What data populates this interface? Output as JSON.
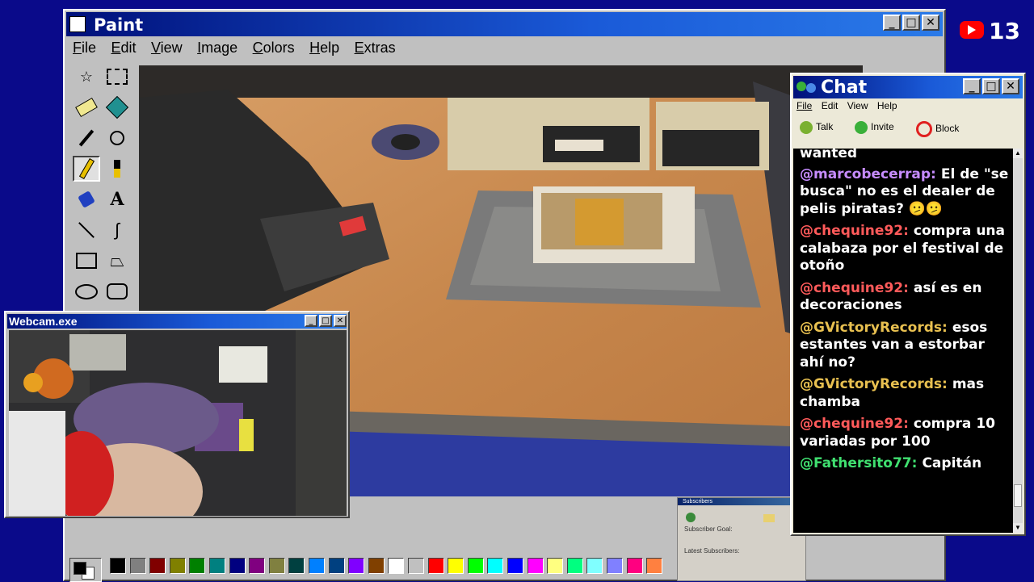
{
  "paint": {
    "title": "Paint",
    "menu": [
      "File",
      "Edit",
      "View",
      "Image",
      "Colors",
      "Help",
      "Extras"
    ],
    "tools": [
      "free-select-icon",
      "rect-select-icon",
      "eraser-icon",
      "fill-bucket-icon",
      "color-picker-icon",
      "magnifier-icon",
      "pencil-icon",
      "brush-icon",
      "airbrush-icon",
      "text-icon",
      "line-icon",
      "curve-icon",
      "rectangle-icon",
      "polygon-icon",
      "ellipse-icon",
      "rounded-rect-icon"
    ],
    "palette": [
      "#000000",
      "#808080",
      "#800000",
      "#808000",
      "#008000",
      "#008080",
      "#000080",
      "#800080",
      "#808040",
      "#004040",
      "#0080ff",
      "#004080",
      "#8000ff",
      "#804000",
      "#ffffff",
      "#c0c0c0",
      "#ff0000",
      "#ffff00",
      "#00ff00",
      "#00ffff",
      "#0000ff",
      "#ff00ff",
      "#ffff80",
      "#00ff80",
      "#80ffff",
      "#8080ff",
      "#ff0080",
      "#ff8040"
    ],
    "primary_color": "#000000",
    "secondary_color": "#ffffff"
  },
  "badge": {
    "count": "13",
    "icon": "youtube-icon"
  },
  "webcam": {
    "title": "Webcam.exe"
  },
  "subscribers": {
    "title": "Subscribers",
    "goal_label": "Subscriber Goal:",
    "latest_label": "Latest Subscribers:"
  },
  "chat": {
    "title": "Chat",
    "menu": [
      "File",
      "Edit",
      "View",
      "Help"
    ],
    "toolbar": {
      "talk": "Talk",
      "invite": "Invite",
      "block": "Block"
    },
    "partial_top": "wanted",
    "messages": [
      {
        "user": "@marcobecerrap:",
        "text": "El de \"se busca\" no es el dealer de pelis piratas? 🫤🫤",
        "color": "#c68cff"
      },
      {
        "user": "@chequine92:",
        "text": "compra una calabaza por el festival de otoño",
        "color": "#ff5a5a"
      },
      {
        "user": "@chequine92:",
        "text": "así es en decoraciones",
        "color": "#ff5a5a"
      },
      {
        "user": "@GVictoryRecords:",
        "text": "esos estantes van a estorbar ahí no?",
        "color": "#e8c050"
      },
      {
        "user": "@GVictoryRecords:",
        "text": "mas chamba",
        "color": "#e8c050"
      },
      {
        "user": "@chequine92:",
        "text": "compra 10 variadas por 100",
        "color": "#ff5a5a"
      },
      {
        "user": "@Fathersito77:",
        "text": "Capitán",
        "color": "#40e070"
      }
    ]
  }
}
